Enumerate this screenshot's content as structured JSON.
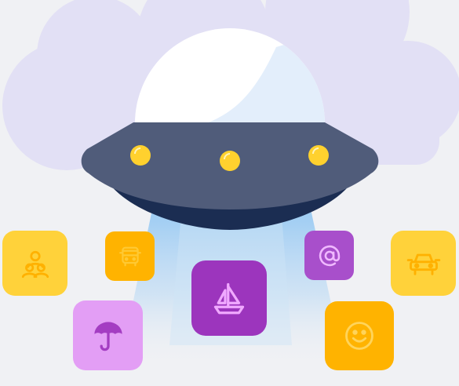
{
  "illustration": {
    "subject": "ufo-abduction",
    "colors": {
      "background": "#f0f1f4",
      "cloud": "#e2e0f5",
      "dome": "#ffffff",
      "dome_shade": "#e3eefb",
      "saucer_top": "#505c7a",
      "saucer_bottom": "#1b2d52",
      "lights": "#ffd12e",
      "beam": "#8ec5f2"
    }
  },
  "icons": [
    {
      "icon": "people-icon",
      "bg": "#ffd23a",
      "fg": "#ffb100"
    },
    {
      "icon": "bus-icon",
      "bg": "#ffb300",
      "fg": "#ffc933"
    },
    {
      "icon": "umbrella-icon",
      "bg": "#e39ef5",
      "fg": "#a43dc2"
    },
    {
      "icon": "sailboat-icon",
      "bg": "#9c35bd",
      "fg": "#f0a9ff"
    },
    {
      "icon": "at-sign-icon",
      "bg": "#a84fcb",
      "fg": "#f0b9ff"
    },
    {
      "icon": "smiley-icon",
      "bg": "#ffb300",
      "fg": "#ffd45a"
    },
    {
      "icon": "car-icon",
      "bg": "#ffd23a",
      "fg": "#ffb100"
    }
  ]
}
